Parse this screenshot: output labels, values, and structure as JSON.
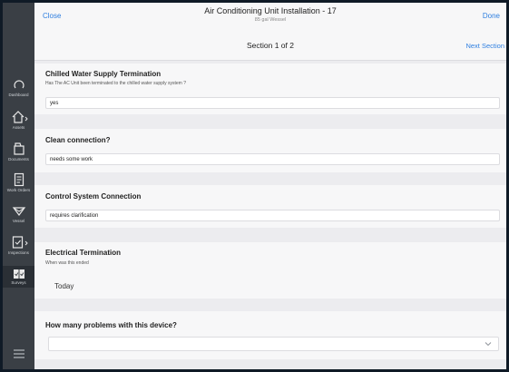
{
  "sidebar": {
    "items": [
      {
        "label": "Dashboard",
        "icon": "circle-icon"
      },
      {
        "label": "Assets",
        "icon": "home-icon"
      },
      {
        "label": "Documents",
        "icon": "folder-icon"
      },
      {
        "label": "Work Orders",
        "icon": "document-icon"
      },
      {
        "label": "Vessel",
        "icon": "vessel-icon"
      },
      {
        "label": "Inspections",
        "icon": "checklist-icon"
      },
      {
        "label": "Surveys",
        "icon": "survey-icon"
      }
    ],
    "menu_icon": "hamburger-menu-icon"
  },
  "header": {
    "close_label": "Close",
    "title": "Air Conditioning Unit Installation - 17",
    "subtitle": "85 gal Wessel",
    "done_label": "Done"
  },
  "section": {
    "label": "Section 1 of 2",
    "next_label": "Next Section"
  },
  "questions": [
    {
      "title": "Chilled Water Supply Termination",
      "subtitle": "Has The AC Unit been terminated to the chilled water supply system ?",
      "answer": "yes"
    },
    {
      "title": "Clean connection?",
      "answer": "needs some work"
    },
    {
      "title": "Control System Connection",
      "answer": "requires clarification"
    },
    {
      "title": "Electrical Termination",
      "subtitle": "When was this ended",
      "answer": "Today"
    },
    {
      "title": "How many problems with this device?",
      "answer": ""
    }
  ],
  "colors": {
    "accent": "#2f7fe0",
    "sidebar_bg": "#3a3f45",
    "content_bg": "#ececef"
  }
}
